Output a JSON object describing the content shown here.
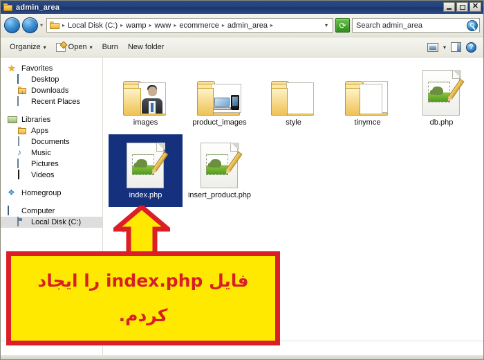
{
  "window": {
    "title": "admin_area",
    "title_icon": "folder-icon",
    "controls": {
      "minimize": "minimize-button",
      "maximize": "maximize-button",
      "close": "close-button",
      "close_glyph": "✕"
    }
  },
  "address_bar": {
    "back_label": "◀",
    "forward_label": "▶",
    "history_caret": "▾",
    "breadcrumbs": [
      "Local Disk (C:)",
      "wamp",
      "www",
      "ecommerce",
      "admin_area"
    ],
    "separator": "▸",
    "dropdown_caret": "▾",
    "refresh_label": "⟳",
    "search": {
      "placeholder": "Search admin_area",
      "value": "Search admin_area",
      "icon": "search-icon"
    }
  },
  "toolbar": {
    "organize_label": "Organize",
    "open_label": "Open",
    "burn_label": "Burn",
    "new_folder_label": "New folder",
    "caret": "▾",
    "help_label": "?"
  },
  "sidebar": {
    "groups": [
      {
        "header": {
          "label": "Favorites",
          "icon": "star-icon"
        },
        "items": [
          {
            "label": "Desktop",
            "icon": "desktop-icon"
          },
          {
            "label": "Downloads",
            "icon": "downloads-folder-icon"
          },
          {
            "label": "Recent Places",
            "icon": "recent-places-icon"
          }
        ]
      },
      {
        "header": {
          "label": "Libraries",
          "icon": "libraries-icon"
        },
        "items": [
          {
            "label": "Apps",
            "icon": "folder-icon"
          },
          {
            "label": "Documents",
            "icon": "document-icon"
          },
          {
            "label": "Music",
            "icon": "music-note-icon"
          },
          {
            "label": "Pictures",
            "icon": "picture-icon"
          },
          {
            "label": "Videos",
            "icon": "video-icon"
          }
        ]
      },
      {
        "header": {
          "label": "Homegroup",
          "icon": "homegroup-icon"
        },
        "items": []
      },
      {
        "header": {
          "label": "Computer",
          "icon": "computer-icon"
        },
        "items": [
          {
            "label": "Local Disk (C:)",
            "icon": "disk-icon",
            "selected": true
          }
        ]
      }
    ]
  },
  "files": [
    {
      "name": "images",
      "type": "folder",
      "thumb": "person",
      "selected": false
    },
    {
      "name": "product_images",
      "type": "folder",
      "thumb": "devices",
      "selected": false
    },
    {
      "name": "style",
      "type": "folder",
      "thumb": "blank",
      "selected": false
    },
    {
      "name": "tinymce",
      "type": "folder",
      "thumb": "papers",
      "selected": false
    },
    {
      "name": "db.php",
      "type": "php-file",
      "thumb": "php",
      "selected": false
    },
    {
      "name": "index.php",
      "type": "php-file",
      "thumb": "php",
      "selected": true
    },
    {
      "name": "insert_product.php",
      "type": "php-file",
      "thumb": "php",
      "selected": false
    }
  ],
  "annotation": {
    "arrow": "up-arrow-pointing-to-index-php",
    "line1": "فایل index.php را ایجاد",
    "line2": "کردم.",
    "box_color": "#ffe900",
    "border_color": "#dc1f26",
    "text_color": "#d81f26"
  }
}
